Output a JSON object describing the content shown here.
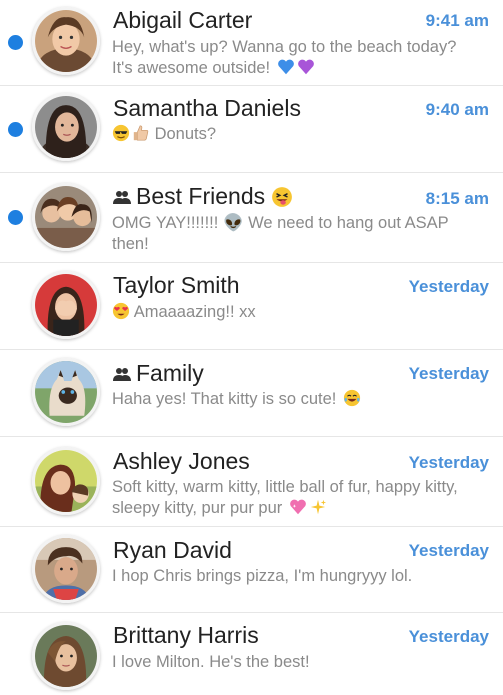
{
  "conversations": [
    {
      "name": "Abigail Carter",
      "time": "9:41 am",
      "unread": true,
      "group": false,
      "preview": "Hey, what's up? Wanna go to the beach today? It's awesome outside!",
      "name_emoji": "",
      "preview_emojis": [
        "blue-heart",
        "purple-heart"
      ],
      "preview_lead_emojis": []
    },
    {
      "name": "Samantha Daniels",
      "time": "9:40 am",
      "unread": true,
      "group": false,
      "preview": "Donuts?",
      "name_emoji": "",
      "preview_emojis": [],
      "preview_lead_emojis": [
        "sunglasses-face",
        "thumbs-up"
      ]
    },
    {
      "name": "Best Friends",
      "time": "8:15 am",
      "unread": true,
      "group": true,
      "preview": "OMG YAY!!!!!!! 👽 We need to hang out ASAP then!",
      "name_emoji": "tongue-face",
      "preview_emojis": [],
      "preview_lead_emojis": []
    },
    {
      "name": "Taylor Smith",
      "time": "Yesterday",
      "unread": false,
      "group": false,
      "preview": "Amaaaazing!! xx",
      "name_emoji": "",
      "preview_emojis": [],
      "preview_lead_emojis": [
        "heart-eyes"
      ]
    },
    {
      "name": "Family",
      "time": "Yesterday",
      "unread": false,
      "group": true,
      "preview": "Haha yes! That kitty is so cute!",
      "name_emoji": "",
      "preview_emojis": [
        "tears-of-joy"
      ],
      "preview_lead_emojis": []
    },
    {
      "name": "Ashley Jones",
      "time": "Yesterday",
      "unread": false,
      "group": false,
      "preview": "Soft kitty, warm kitty, little ball of fur, happy kitty, sleepy kitty, pur pur pur",
      "name_emoji": "",
      "preview_emojis": [
        "sparkling-heart",
        "sparkles"
      ],
      "preview_lead_emojis": []
    },
    {
      "name": "Ryan David",
      "time": "Yesterday",
      "unread": false,
      "group": false,
      "preview": "I hop Chris brings pizza, I'm hungryyy lol.",
      "name_emoji": "",
      "preview_emojis": [],
      "preview_lead_emojis": []
    },
    {
      "name": "Brittany Harris",
      "time": "Yesterday",
      "unread": false,
      "group": false,
      "preview": "I love Milton. He's the best!",
      "name_emoji": "",
      "preview_emojis": [],
      "preview_lead_emojis": []
    }
  ],
  "colors": {
    "unread_dot": "#1e7fe0",
    "time": "#4a90d9",
    "name": "#222222",
    "preview": "#8a8a8a"
  }
}
